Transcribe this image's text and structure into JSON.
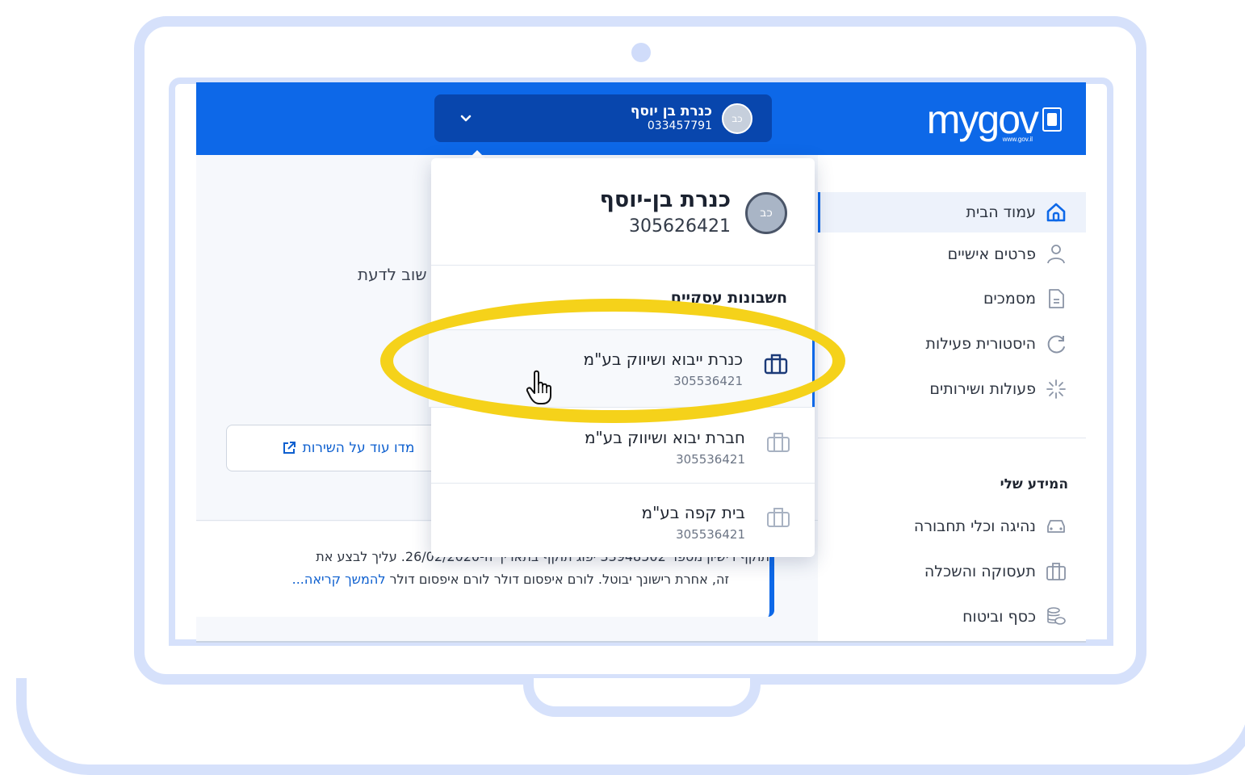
{
  "header": {
    "logo_text": "mygov",
    "logo_sub": "www.gov.il",
    "user_switch": {
      "avatar_initials": "כב",
      "name": "כנרת בן יוסף",
      "id": "033457791"
    }
  },
  "dropdown": {
    "avatar_initials": "כב",
    "name": "כנרת בן-יוסף",
    "id": "305626421",
    "section_title": "חשבונות עסקיים",
    "accounts": [
      {
        "name": "כנרת ייבוא ושיווק בע\"מ",
        "id": "305536421"
      },
      {
        "name": "חברת יבוא ושיווק בע\"מ",
        "id": "305536421"
      },
      {
        "name": "בית קפה בע\"מ",
        "id": "305536421"
      }
    ]
  },
  "sidebar": {
    "items": [
      {
        "label": "עמוד הבית",
        "icon": "home-icon"
      },
      {
        "label": "פרטים אישיים",
        "icon": "person-icon"
      },
      {
        "label": "מסמכים",
        "icon": "document-icon"
      },
      {
        "label": "היסטורית פעילות",
        "icon": "history-icon"
      },
      {
        "label": "פעולות ושירותים",
        "icon": "sparkle-icon"
      }
    ],
    "section_heading": "המידע שלי",
    "info_items": [
      {
        "label": "נהיגה וכלי תחבורה",
        "icon": "car-icon"
      },
      {
        "label": "תעסוקה והשכלה",
        "icon": "briefcase-icon"
      },
      {
        "label": "כסף וביטוח",
        "icon": "coins-icon"
      }
    ]
  },
  "main": {
    "partial_text": "שוב לדעת",
    "learn_more_button": "מדו עוד על השירות",
    "notice_line1": "תוקף רישיון מספר 33948502 יפוג תוקף בתאריך ה-26/02/2020. עליך לבצע את",
    "notice_line2_text": "זה, אחרת רישונך יבוטל. לורם איפסום דולר לורם איפסום דולר ",
    "notice_link": "להמשך קריאה..."
  },
  "colors": {
    "primary": "#0d68e8",
    "header_dark": "#0846ad",
    "highlight": "#f5d21a",
    "frame": "#d6e1fb"
  }
}
